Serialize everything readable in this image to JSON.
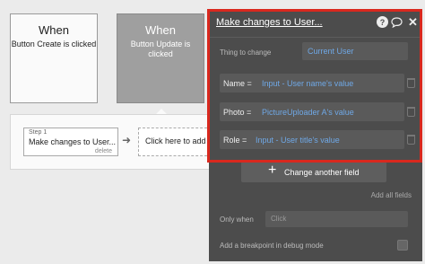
{
  "event_create": {
    "title": "When",
    "subtitle": "Button Create is clicked"
  },
  "event_update": {
    "title": "When",
    "subtitle": "Button Update is clicked"
  },
  "step": {
    "label": "Step 1",
    "name": "Make changes to User...",
    "delete": "delete"
  },
  "add_action": {
    "label": "Click here to add an action..."
  },
  "panel": {
    "title": "Make changes to User...",
    "help_icon": "question-circle-icon",
    "comment_icon": "comment-icon",
    "close_icon": "close-icon",
    "thing_label": "Thing to change",
    "thing_value": "Current User",
    "fields": [
      {
        "name": "Name",
        "op": "=",
        "value": "Input - User name's value"
      },
      {
        "name": "Photo",
        "op": "=",
        "value": "PictureUploader A's value"
      },
      {
        "name": "Role",
        "op": "=",
        "value": "Input - User title's value"
      }
    ],
    "change_field_label": "Change another field",
    "add_all_label": "Add all fields",
    "only_when_label": "Only when",
    "only_when_placeholder": "Click",
    "breakpoint_label": "Add a breakpoint in debug mode"
  },
  "colors": {
    "panel_bg": "#4c4c4c",
    "value_text": "#6fa8e6",
    "highlight": "#d9281e"
  }
}
